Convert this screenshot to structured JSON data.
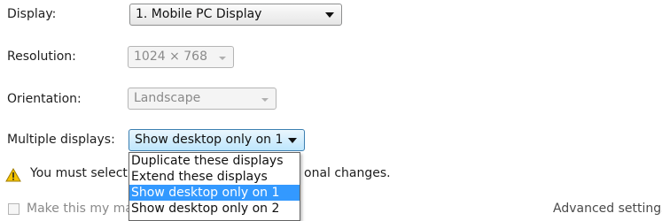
{
  "display": {
    "label": "Display:",
    "value": "1. Mobile PC Display"
  },
  "resolution": {
    "label": "Resolution:",
    "value": "1024 × 768"
  },
  "orientation": {
    "label": "Orientation:",
    "value": "Landscape"
  },
  "multiple_displays": {
    "label": "Multiple displays:",
    "value": "Show desktop only on 1",
    "options": [
      "Duplicate these displays",
      "Extend these displays",
      "Show desktop only on 1",
      "Show desktop only on 2"
    ],
    "selected_index": 2
  },
  "warning": {
    "text_start": "You must select",
    "text_end": "onal changes."
  },
  "primary_checkbox": {
    "label": "Make this my ma",
    "checked": false
  },
  "advanced_link": "Advanced settings"
}
